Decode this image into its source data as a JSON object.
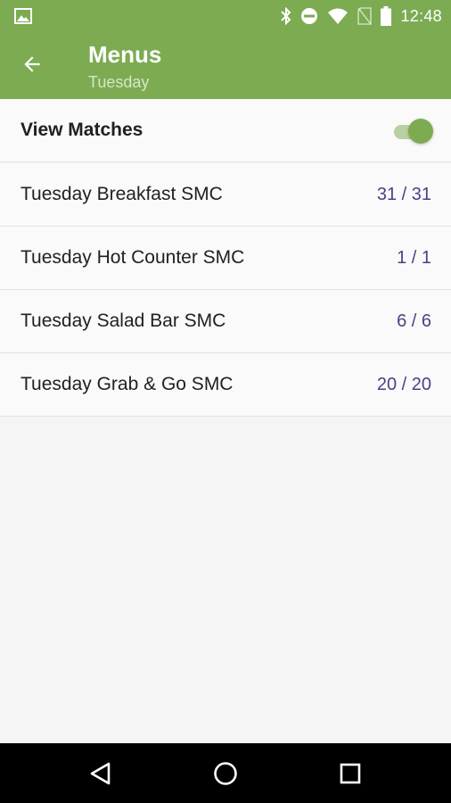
{
  "status_bar": {
    "time": "12:48",
    "icons": [
      "image-icon",
      "bluetooth-icon",
      "do-not-disturb-icon",
      "wifi-icon",
      "no-sim-icon",
      "battery-icon"
    ]
  },
  "app_bar": {
    "title": "Menus",
    "subtitle": "Tuesday",
    "back_icon": "arrow-back-icon"
  },
  "view_matches": {
    "label": "View Matches",
    "enabled": true
  },
  "menus": [
    {
      "name": "Tuesday Breakfast SMC",
      "count": "31 / 31"
    },
    {
      "name": "Tuesday Hot Counter SMC",
      "count": "1 / 1"
    },
    {
      "name": "Tuesday Salad Bar SMC",
      "count": "6 / 6"
    },
    {
      "name": "Tuesday Grab & Go SMC",
      "count": "20 / 20"
    }
  ],
  "nav_bar": {
    "buttons": [
      "back-triangle-icon",
      "home-circle-icon",
      "recents-square-icon"
    ]
  },
  "colors": {
    "primary": "#7cab52",
    "count_text": "#4c3f8a",
    "background": "#f5f5f5"
  }
}
